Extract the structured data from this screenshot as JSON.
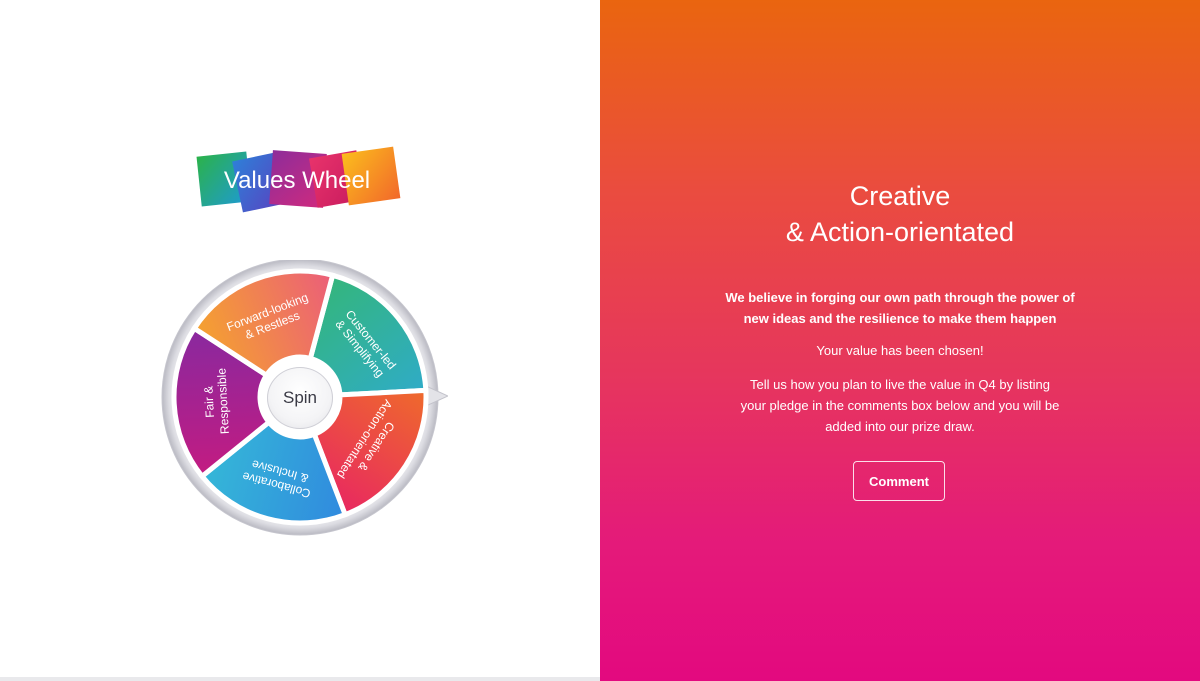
{
  "logo": {
    "text": "Values Wheel",
    "colors": [
      "#2bb24a",
      "#2e7fd8",
      "#8e2d9a",
      "#e8336b",
      "#f7a21c"
    ]
  },
  "wheel": {
    "spin_label": "Spin",
    "pointer_icon": "pointer-triangle-icon",
    "segments": [
      {
        "label_line1": "Customer-led",
        "label_line2": "& Simplifying",
        "color_start": "#35b86a",
        "color_end": "#2ea9d9"
      },
      {
        "label_line1": "Creative &",
        "label_line2": "Action-orientated",
        "color_start": "#f07a1f",
        "color_end": "#e7186d"
      },
      {
        "label_line1": "Collaborative",
        "label_line2": "& Inclusive",
        "color_start": "#2f7fe0",
        "color_end": "#36c2d6"
      },
      {
        "label_line1": "Fair &",
        "label_line2": "Responsible",
        "color_start": "#d1187a",
        "color_end": "#7b2ca6"
      },
      {
        "label_line1": "Forward-looking",
        "label_line2": "& Restless",
        "color_start": "#f7b21d",
        "color_end": "#e94e8b"
      }
    ]
  },
  "result": {
    "title_line1": "Creative",
    "title_line2": "& Action-orientated",
    "lead": "We believe in forging our own path through the power of new ideas and the resilience to make them happen",
    "chosen": "Your value has been chosen!",
    "instructions": "Tell us how you plan to live the value in Q4 by listing your pledge in the comments box below and you will be added into our prize draw.",
    "comment_label": "Comment"
  }
}
